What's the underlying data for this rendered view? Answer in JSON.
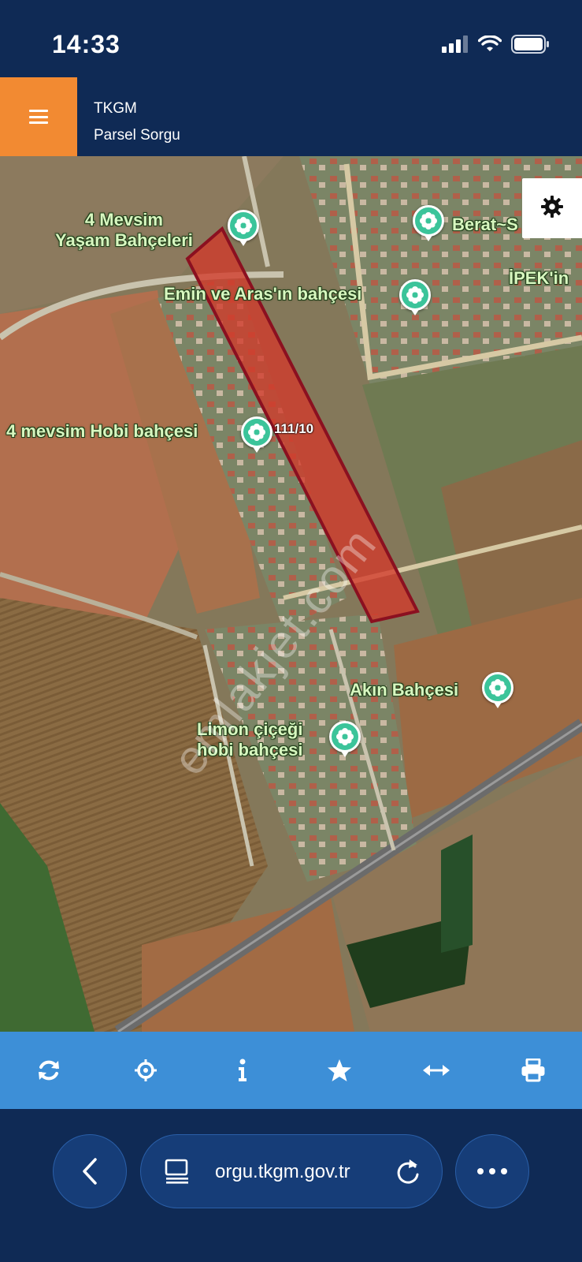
{
  "status_bar": {
    "time": "14:33",
    "icons": [
      "signal-icon",
      "wifi-icon",
      "battery-icon"
    ]
  },
  "header": {
    "menu_icon": "hamburger-icon",
    "title": "TKGM",
    "subtitle": "Parsel Sorgu"
  },
  "map": {
    "places": [
      {
        "name": "4 Mevsim\nYaşam Bahçeleri"
      },
      {
        "name": "Berat~S"
      },
      {
        "name": "İPEK'in"
      },
      {
        "name": "Emin ve Aras'ın bahçesi"
      },
      {
        "name": "4 mevsim Hobi bahçesi"
      },
      {
        "name": "Akın Bahçesi"
      },
      {
        "name": "Limon çiçeği\nhobi bahçesi"
      }
    ],
    "parcel_label": "111/10",
    "watermark": "emlakjet.com",
    "settings_icon": "gear-icon"
  },
  "toolbar": {
    "buttons": [
      "refresh-icon",
      "locate-icon",
      "info-icon",
      "star-icon",
      "measure-icon",
      "print-icon"
    ]
  },
  "browser": {
    "url": "orgu.tkgm.gov.tr",
    "back_icon": "chevron-left-icon",
    "tabs_icon": "reader-icon",
    "reload_icon": "reload-icon",
    "more_icon": "more-icon"
  },
  "colors": {
    "header_bg": "#0f2a55",
    "menu_accent": "#f28a32",
    "toolbar_bg": "#3d8fd7",
    "parcel_fill": "#d23a2a",
    "parcel_stroke": "#8b1020",
    "pin": "#3bc49a"
  }
}
